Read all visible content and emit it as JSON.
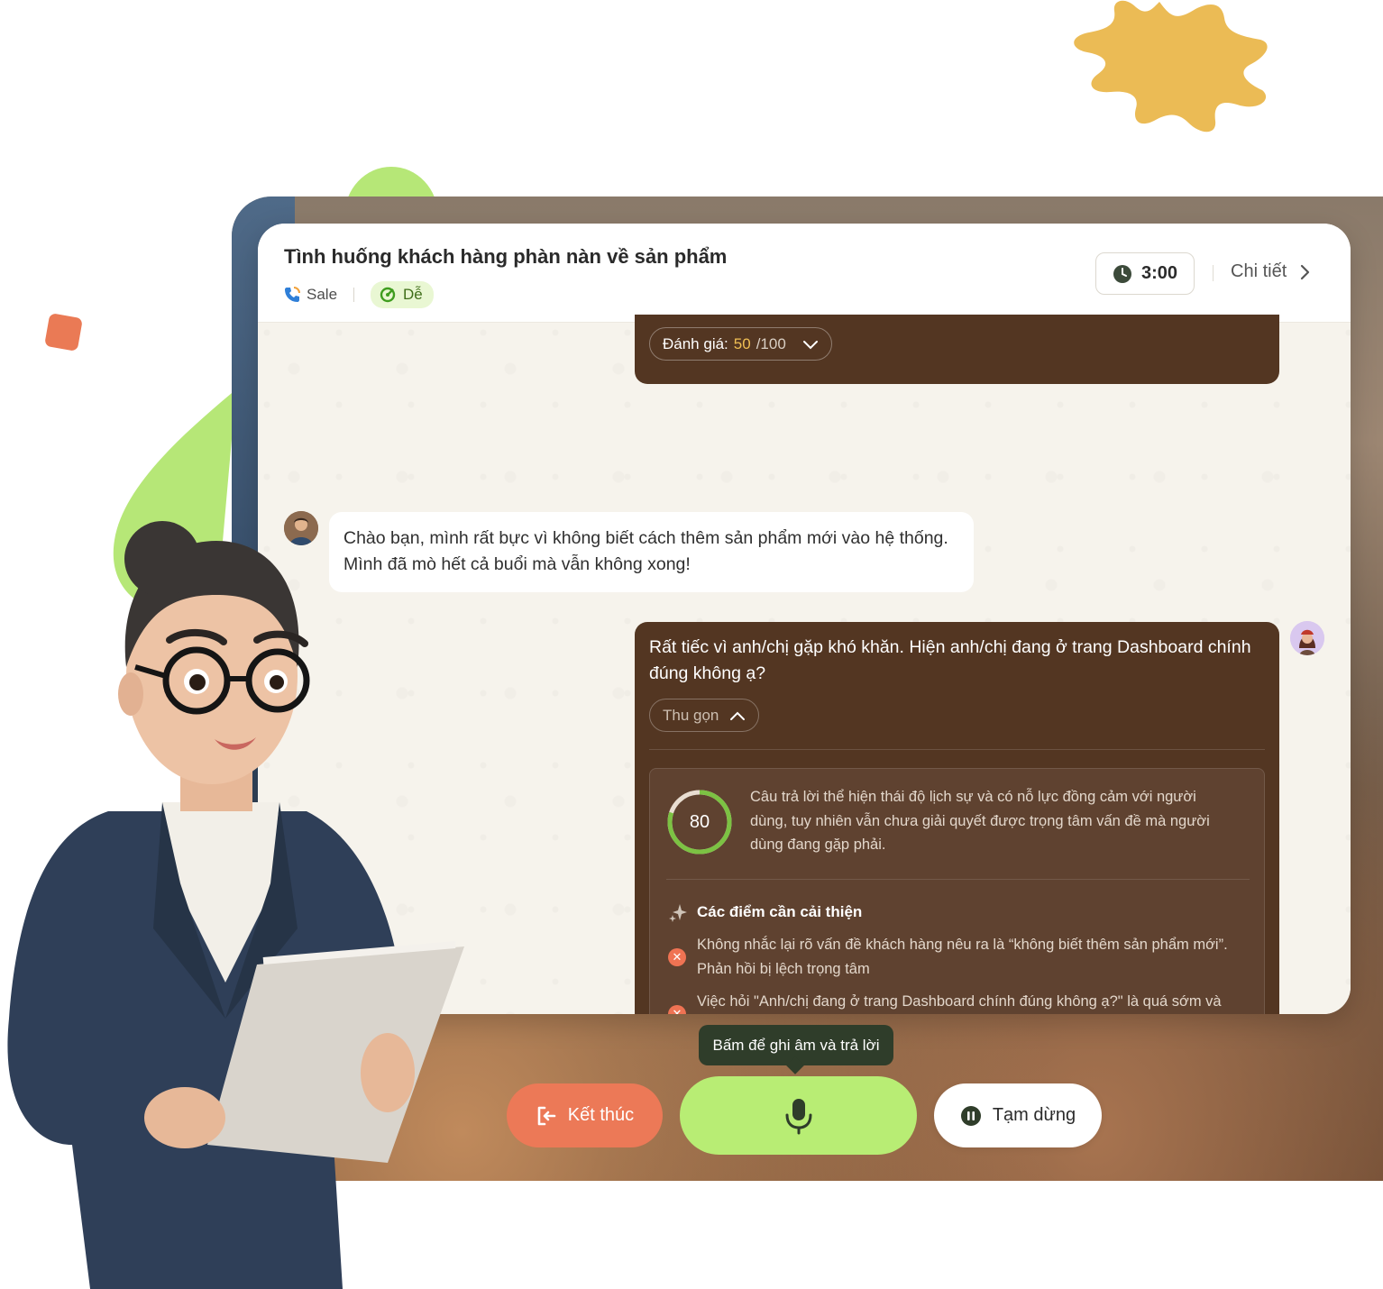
{
  "header": {
    "title": "Tình huống khách hàng phàn nàn về sản phẩm",
    "category": "Sale",
    "level": "Dễ",
    "timer": "3:00",
    "detail_label": "Chi tiết"
  },
  "score_bubble": {
    "label": "Đánh giá:",
    "score": "50",
    "max": "/100"
  },
  "user_message": {
    "text_line1": "Chào bạn, mình rất bực vì không biết cách thêm sản phẩm mới vào hệ thống.",
    "text_line2": "Mình đã mò hết cả buổi mà vẫn không xong!"
  },
  "ai_message": {
    "text": "Rất tiếc vì anh/chị gặp khó khăn. Hiện anh/chị đang ở trang Dashboard chính đúng không ạ?",
    "collapse_label": "Thu gọn",
    "feedback": {
      "score": "80",
      "score_fraction": 0.8,
      "summary": "Câu trả lời thể hiện thái độ lịch sự và có nỗ lực đồng cảm với người dùng, tuy nhiên vẫn chưa giải quyết được trọng tâm vấn đề mà người dùng đang gặp phải.",
      "improve_title": "Các điểm cần cải thiện",
      "issues": [
        "Không nhắc lại rõ vấn đề khách hàng nêu ra là “không biết thêm sản phẩm mới”. Phản hồi bị lệch trọng tâm",
        "Việc hỏi \"Anh/chị đang ở trang Dashboard chính đúng không ạ?\" là quá sớm và không hướng khách hàng đến giải pháp cụ thể"
      ]
    }
  },
  "controls": {
    "tooltip": "Bấm để ghi âm và trả lời",
    "end_label": "Kết thúc",
    "pause_label": "Tạm dừng"
  },
  "colors": {
    "accent_green": "#b8ed74",
    "end_orange": "#ec7957",
    "bubble_brown": "#533622",
    "score_yellow": "#f0bf54"
  },
  "icons": [
    "clock-icon",
    "chevron-right-icon",
    "chevron-down-icon",
    "chevron-up-icon",
    "phone-icon",
    "level-icon",
    "sparkle-icon",
    "x-circle-icon",
    "exit-icon",
    "microphone-icon",
    "pause-icon"
  ]
}
